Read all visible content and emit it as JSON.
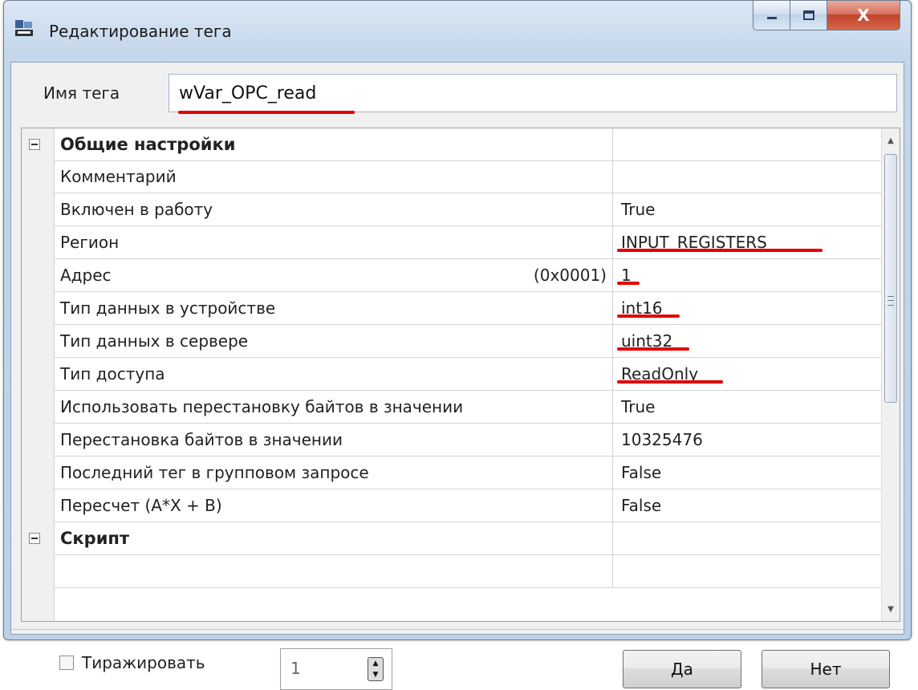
{
  "window": {
    "title": "Редактирование тега",
    "close_glyph": "X",
    "icon": "app-icon",
    "accent_color": "#e00000"
  },
  "tag_name": {
    "label": "Имя тега",
    "value": "wVar_OPC_read"
  },
  "properties": {
    "sections": [
      {
        "label": "Общие настройки"
      },
      {
        "label": "Скрипт"
      }
    ],
    "rows": [
      {
        "name": "Комментарий",
        "value": ""
      },
      {
        "name": "Включен в работу",
        "value": "True"
      },
      {
        "name": "Регион",
        "value": "INPUT_REGISTERS"
      },
      {
        "name": "Адрес",
        "hex": "(0x0001)",
        "value": "1"
      },
      {
        "name": "Тип данных в устройстве",
        "value": "int16"
      },
      {
        "name": "Тип данных в сервере",
        "value": "uint32"
      },
      {
        "name": "Тип доступа",
        "value": "ReadOnly"
      },
      {
        "name": "Использовать перестановку байтов в значении",
        "value": "True"
      },
      {
        "name": "Перестановка байтов в значении",
        "value": "10325476"
      },
      {
        "name": "Последний тег в групповом запросе",
        "value": "False"
      },
      {
        "name": "Пересчет (A*X + B)",
        "value": "False"
      }
    ]
  },
  "footer": {
    "replicate_label": "Тиражировать",
    "replicate_checked": false,
    "count_value": "1",
    "ok_label": "Да",
    "cancel_label": "Нет"
  }
}
